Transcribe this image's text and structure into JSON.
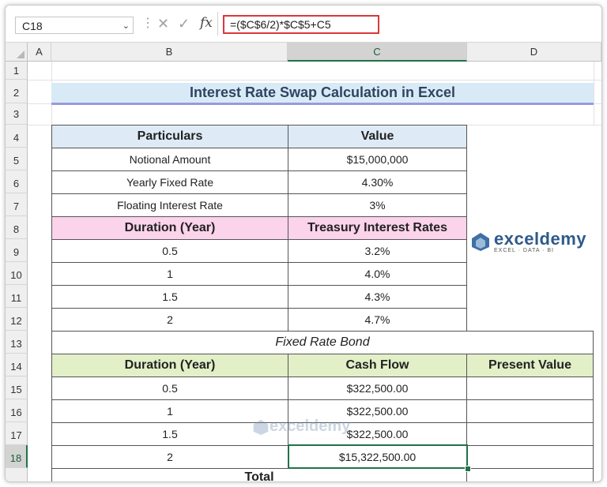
{
  "formula_bar": {
    "name_box": "C18",
    "fx": "fx",
    "formula": "=($C$6/2)*$C$5+C5"
  },
  "columns": [
    "A",
    "B",
    "C",
    "D"
  ],
  "rows": [
    "1",
    "2",
    "3",
    "4",
    "5",
    "6",
    "7",
    "8",
    "9",
    "10",
    "11",
    "12",
    "13",
    "14",
    "15",
    "16",
    "17",
    "18"
  ],
  "sheet": {
    "title": "Interest Rate Swap Calculation in Excel",
    "table1": {
      "header": [
        "Particulars",
        "Value"
      ],
      "rows": [
        [
          "Notional Amount",
          "$15,000,000"
        ],
        [
          "Yearly Fixed Rate",
          "4.30%"
        ],
        [
          "Floating Interest Rate",
          "3%"
        ]
      ]
    },
    "table2": {
      "header": [
        "Duration (Year)",
        "Treasury Interest Rates"
      ],
      "rows": [
        [
          "0.5",
          "3.2%"
        ],
        [
          "1",
          "4.0%"
        ],
        [
          "1.5",
          "4.3%"
        ],
        [
          "2",
          "4.7%"
        ]
      ]
    },
    "table3": {
      "caption": "Fixed Rate Bond",
      "header": [
        "Duration (Year)",
        "Cash Flow",
        "Present Value"
      ],
      "rows": [
        [
          "0.5",
          "$322,500.00",
          ""
        ],
        [
          "1",
          "$322,500.00",
          ""
        ],
        [
          "1.5",
          "$322,500.00",
          ""
        ],
        [
          "2",
          "$15,322,500.00",
          ""
        ]
      ],
      "total_label": "Total"
    }
  },
  "logo": {
    "name": "exceldemy",
    "tagline": "EXCEL · DATA · BI"
  },
  "colors": {
    "title_fill": "#d9eaf7",
    "header_blue": "#deebf7",
    "header_pink": "#fbd3ea",
    "header_green": "#e2efc7",
    "selection": "#217346",
    "formula_highlight": "#d9383a"
  }
}
